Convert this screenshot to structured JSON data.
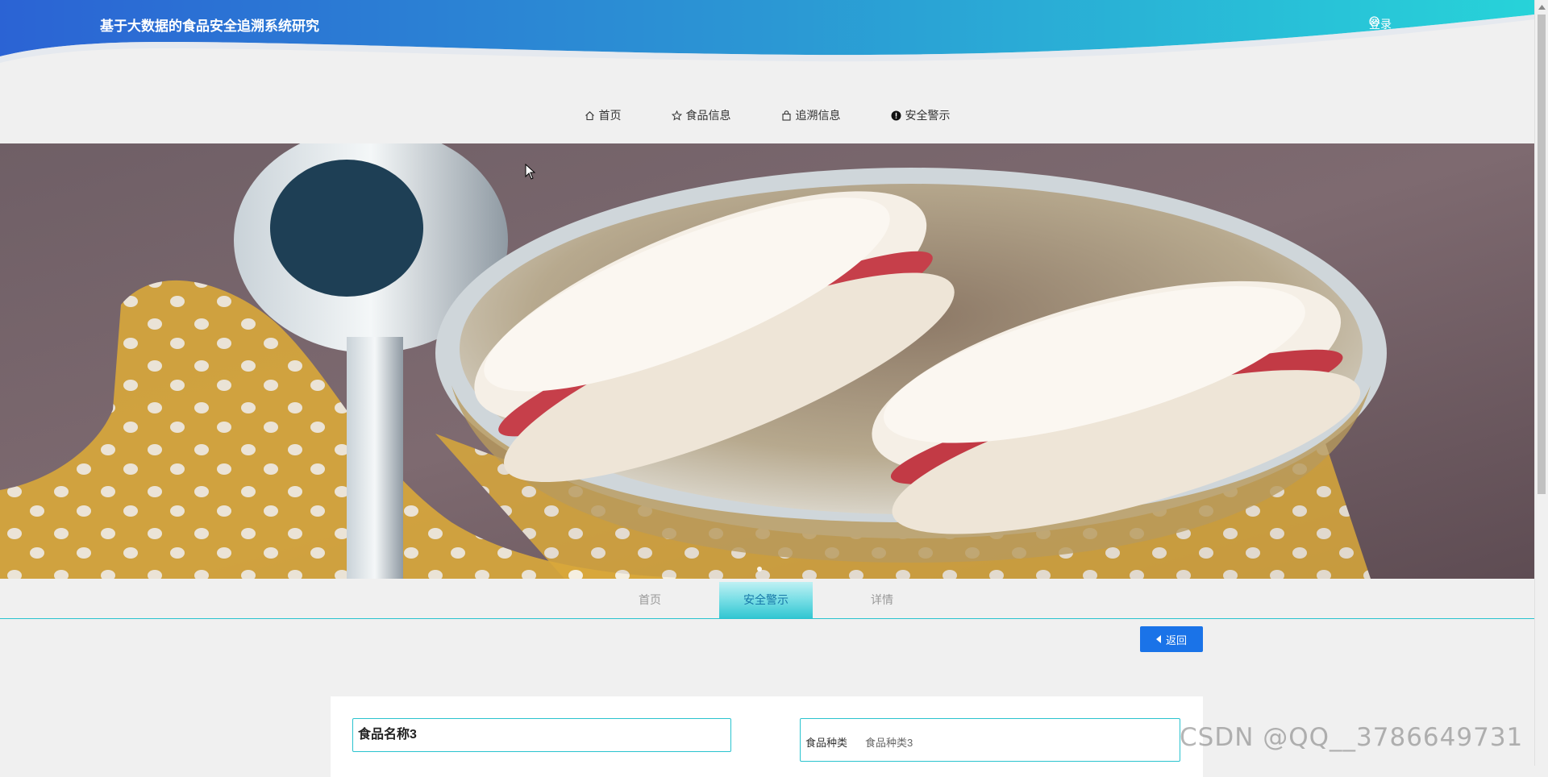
{
  "header": {
    "title": "基于大数据的食品安全追溯系统研究",
    "login_label": "登录"
  },
  "nav": {
    "items": [
      {
        "label": "首页",
        "icon": "home-icon"
      },
      {
        "label": "食品信息",
        "icon": "star-icon"
      },
      {
        "label": "追溯信息",
        "icon": "bag-icon"
      },
      {
        "label": "安全警示",
        "icon": "alert-icon"
      }
    ]
  },
  "banner": {
    "image": "macaron-cookies-in-bowl-photo"
  },
  "breadcrumb_tabs": [
    {
      "label": "首页",
      "active": false
    },
    {
      "label": "安全警示",
      "active": true
    },
    {
      "label": "详情",
      "active": false
    }
  ],
  "back_button": {
    "label": "返回"
  },
  "detail": {
    "name": "食品名称3",
    "fields": [
      {
        "label": "食品种类",
        "value": "食品种类3"
      }
    ]
  },
  "watermark": "CSDN @QQ__3786649731",
  "colors": {
    "accent": "#2ac3cf",
    "header_start": "#2b6bd6",
    "header_end": "#28d0d8",
    "button": "#1a73e8"
  }
}
